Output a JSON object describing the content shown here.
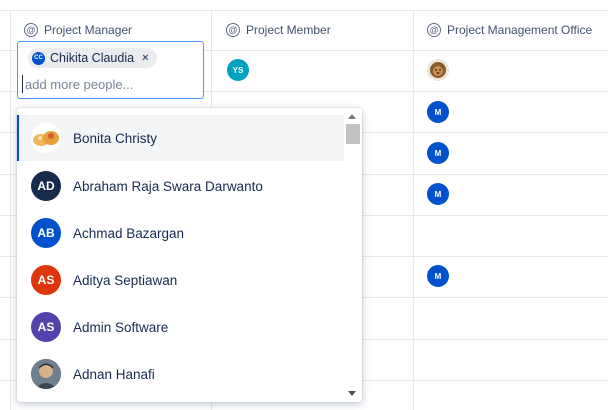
{
  "columns": [
    {
      "label": "Project Manager",
      "icon": "at-sign-icon"
    },
    {
      "label": "Project Member",
      "icon": "at-sign-icon"
    },
    {
      "label": "Project Management Office",
      "icon": "at-sign-icon"
    }
  ],
  "editor": {
    "chip": {
      "initials": "CC",
      "name": "Chikita Claudia",
      "remove": "×"
    },
    "placeholder": "add more people..."
  },
  "member_cells": [
    {
      "initials": "YS",
      "color": "#00a3bf"
    }
  ],
  "pmo_cells": [
    {
      "initials": "",
      "kind": "photo-lion"
    },
    {
      "initials": "M",
      "color": "#0052cc"
    },
    {
      "initials": "M",
      "color": "#0052cc"
    },
    {
      "initials": "M",
      "color": "#0052cc"
    },
    {
      "initials": "M",
      "color": "#0052cc"
    }
  ],
  "dropdown": {
    "options": [
      {
        "name": "Bonita Christy",
        "initials": "",
        "kind": "photo-cake",
        "color": "#f7c56b"
      },
      {
        "name": "Abraham Raja Swara Darwanto",
        "initials": "AD",
        "color": "#172b4d"
      },
      {
        "name": "Achmad Bazargan",
        "initials": "AB",
        "color": "#0052cc"
      },
      {
        "name": "Aditya Septiawan",
        "initials": "AS",
        "color": "#de350b"
      },
      {
        "name": "Admin Software",
        "initials": "AS",
        "color": "#5243aa"
      },
      {
        "name": "Adnan Hanafi",
        "initials": "",
        "kind": "photo-person",
        "color": "#5a6a7a"
      }
    ]
  }
}
